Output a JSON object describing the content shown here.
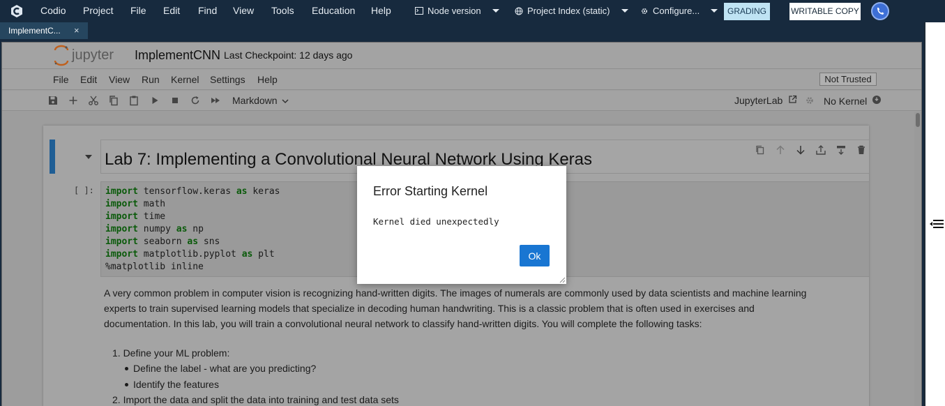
{
  "codio": {
    "menu": [
      "Codio",
      "Project",
      "File",
      "Edit",
      "Find",
      "View",
      "Tools",
      "Education",
      "Help"
    ],
    "node_version": "Node version",
    "project_index": "Project Index (static)",
    "configure": "Configure...",
    "grading": "GRADING",
    "writable_copy": "WRITABLE COPY"
  },
  "tab": {
    "label": "ImplementC...",
    "close": "×"
  },
  "notebook": {
    "brand": "jupyter",
    "title": "ImplementCNN",
    "checkpoint": "Last Checkpoint: 12 days ago",
    "menu": [
      "File",
      "Edit",
      "View",
      "Run",
      "Kernel",
      "Settings",
      "Help"
    ],
    "trust": "Not Trusted",
    "cell_type": "Markdown",
    "jupyterlab_link": "JupyterLab",
    "kernel_status": "No Kernel",
    "heading": "Lab 7: Implementing a Convolutional Neural Network Using Keras",
    "prompt": "[ ]:",
    "code_lines": [
      {
        "kw": "import",
        "rest": " tensorflow.keras ",
        "kw2": "as",
        "rest2": " keras"
      },
      {
        "kw": "import",
        "rest": " math",
        "kw2": "",
        "rest2": ""
      },
      {
        "kw": "import",
        "rest": " time",
        "kw2": "",
        "rest2": ""
      },
      {
        "kw": "import",
        "rest": " numpy ",
        "kw2": "as",
        "rest2": " np"
      },
      {
        "kw": "import",
        "rest": " seaborn ",
        "kw2": "as",
        "rest2": " sns"
      },
      {
        "kw": "import",
        "rest": " matplotlib.pyplot ",
        "kw2": "as",
        "rest2": " plt"
      },
      {
        "kw": "",
        "rest": "%matplotlib inline",
        "kw2": "",
        "rest2": ""
      }
    ],
    "paragraph": [
      "A very common problem in computer vision is recognizing hand-written digits. The images of numerals are commonly used by data scientists and machine learning",
      "experts to train supervised learning models that specialize in decoding human handwriting. This is a classic problem that is often used in exercises and",
      "documentation. In this lab, you will train a convolutional neural network to classify hand-written digits. You will complete the following tasks:"
    ],
    "tasks": {
      "item1": "1. Define your ML problem:",
      "sub1": "Define the label - what are you predicting?",
      "sub2": "Identify the features",
      "item2": "2. Import the data and split the data into training and test data sets"
    }
  },
  "dialog": {
    "title": "Error Starting Kernel",
    "message": "Kernel died unexpectedly",
    "ok": "Ok"
  },
  "colors": {
    "accent": "#1976d2",
    "topbar": "#172a3e",
    "active_cell": "#1f5e95"
  },
  "icons": [
    "codio-logo-icon",
    "terminal-icon",
    "globe-icon",
    "gear-icon",
    "phone-icon",
    "save-icon",
    "plus-icon",
    "scissors-icon",
    "copy-icon",
    "paste-icon",
    "run-icon",
    "stop-icon",
    "restart-icon",
    "fast-forward-icon",
    "chevron-down-icon",
    "external-link-icon",
    "kernel-idle-icon",
    "kernel-circle-icon",
    "duplicate-icon",
    "arrow-up-icon",
    "arrow-down-icon",
    "insert-above-icon",
    "insert-below-icon",
    "trash-icon",
    "sidebar-toggle-icon"
  ]
}
